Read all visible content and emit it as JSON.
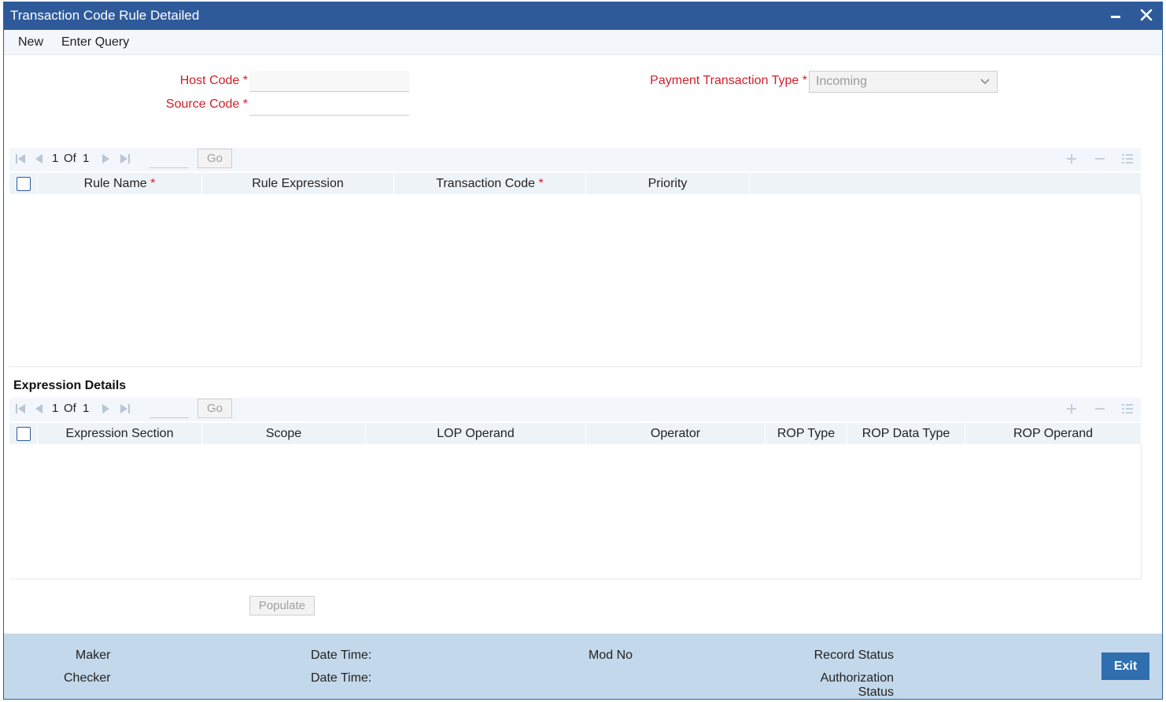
{
  "window": {
    "title": "Transaction Code Rule Detailed"
  },
  "menu": {
    "new_label": "New",
    "enter_query_label": "Enter Query"
  },
  "form": {
    "host_code_label": "Host Code",
    "source_code_label": "Source Code",
    "payment_type_label": "Payment Transaction Type",
    "required_mark": "*",
    "host_code_value": "",
    "source_code_value": "",
    "payment_type_value": "Incoming"
  },
  "rules_grid": {
    "pager": {
      "current": "1",
      "of_label": "Of",
      "total": "1",
      "go_label": "Go"
    },
    "columns": [
      "Rule Name",
      "Rule Expression",
      "Transaction Code",
      "Priority"
    ],
    "required_mark": "*",
    "rows": []
  },
  "expression_details": {
    "title": "Expression Details",
    "pager": {
      "current": "1",
      "of_label": "Of",
      "total": "1",
      "go_label": "Go"
    },
    "columns": [
      "Expression Section",
      "Scope",
      "LOP Operand",
      "Operator",
      "ROP Type",
      "ROP Data Type",
      "ROP Operand"
    ],
    "rows": []
  },
  "populate_label": "Populate",
  "footer": {
    "maker_label": "Maker",
    "checker_label": "Checker",
    "date_time_label_1": "Date Time:",
    "date_time_label_2": "Date Time:",
    "mod_no_label": "Mod No",
    "record_status_label": "Record Status",
    "authorization_label_line1": "Authorization",
    "authorization_label_line2": "Status",
    "exit_label": "Exit"
  },
  "colors": {
    "title_bar": "#2f5a9a",
    "required": "#d01f2c",
    "footer": "#c3d8ea",
    "exit_button": "#2f6fb0"
  }
}
